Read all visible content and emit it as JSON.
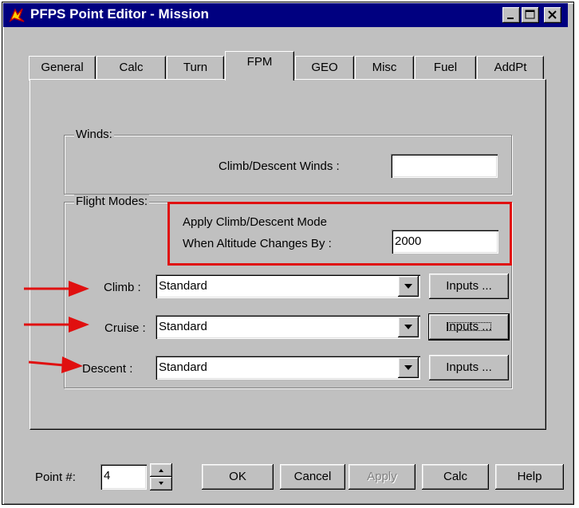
{
  "window": {
    "title": "PFPS Point Editor - Mission",
    "icon": "pfps-app-icon",
    "controls": [
      "minimize-icon",
      "maximize-icon",
      "close-icon"
    ]
  },
  "tabs": [
    "General",
    "Calc",
    "Turn",
    "FPM",
    "GEO",
    "Misc",
    "Fuel",
    "AddPt"
  ],
  "active_tab": "FPM",
  "winds": {
    "group_label": "Winds:",
    "climb_descent_label": "Climb/Descent Winds :",
    "climb_descent_value": ""
  },
  "flight_modes": {
    "group_label": "Flight Modes:",
    "apply_line1": "Apply Climb/Descent Mode",
    "apply_line2": "When Altitude Changes By :",
    "altitude_value": "2000",
    "rows": [
      {
        "label": "Climb :",
        "value": "Standard",
        "button": "Inputs ..."
      },
      {
        "label": "Cruise :",
        "value": "Standard",
        "button": "Inputs ..."
      },
      {
        "label": "Descent :",
        "value": "Standard",
        "button": "Inputs ..."
      }
    ]
  },
  "footer": {
    "point_label": "Point #:",
    "point_value": "4",
    "buttons": {
      "ok": "OK",
      "cancel": "Cancel",
      "apply": "Apply",
      "calc": "Calc",
      "help": "Help"
    }
  },
  "colors": {
    "highlight": "#e01010",
    "titlebar": "#000080",
    "face": "#c0c0c0"
  }
}
